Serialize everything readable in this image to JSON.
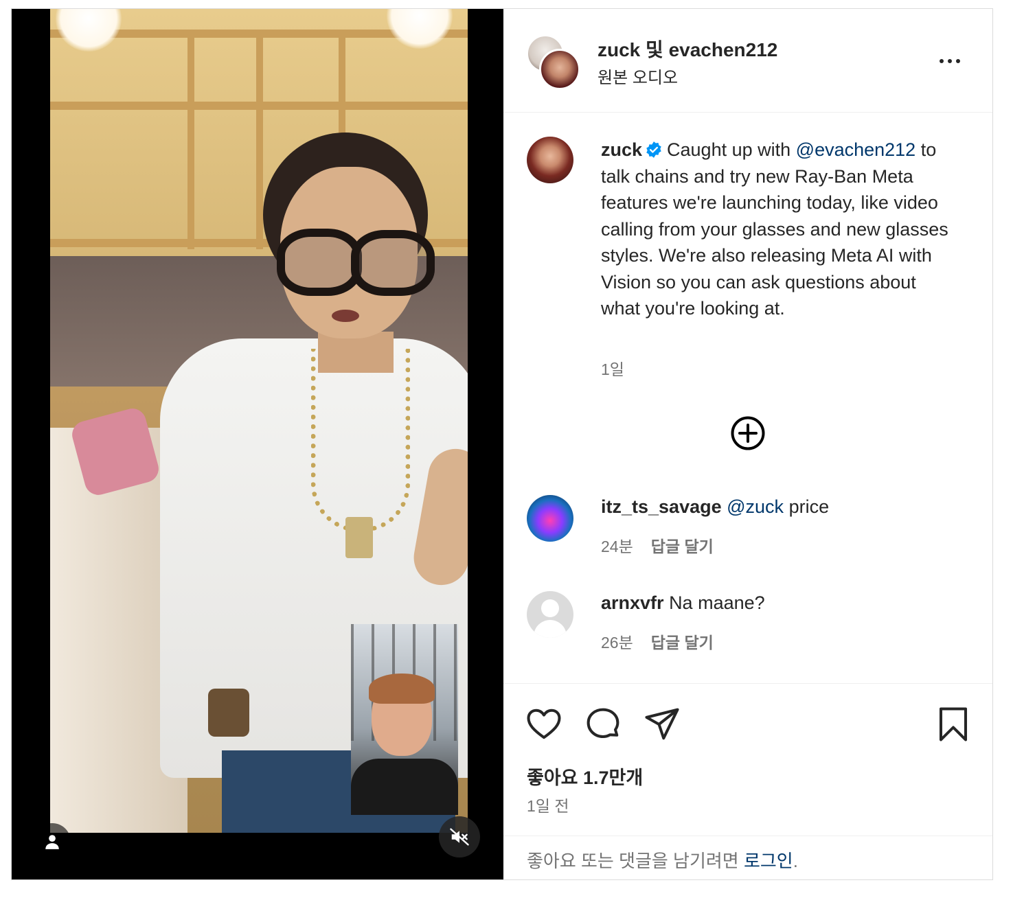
{
  "post": {
    "header": {
      "title": "zuck 및 evachen212",
      "subtitle": "원본 오디오"
    },
    "caption": {
      "username": "zuck",
      "text_before": "Caught up with ",
      "mention": "@evachen212",
      "text_after": " to talk chains and try new Ray-Ban Meta features we're launching today, like video calling from your glasses and new glasses styles. We're also releasing Meta AI with Vision so you can ask questions about what you're looking at.",
      "time": "1일"
    },
    "comments": [
      {
        "username": "itz_ts_savage",
        "mention": "@zuck",
        "text": "price",
        "time": "24분",
        "reply_label": "답글 달기"
      },
      {
        "username": "arnxvfr",
        "mention": "",
        "text": "Na maane?",
        "time": "26분",
        "reply_label": "답글 달기"
      }
    ],
    "likes_label": "좋아요 1.7만개",
    "date_label": "1일 전",
    "footer": {
      "text": "좋아요 또는 댓글을 남기려면 ",
      "login": "로그인",
      "suffix": "."
    }
  },
  "icons": {
    "more": "more-horizontal-icon",
    "verified": "verified-badge-icon",
    "load_more": "plus-circle-icon",
    "like": "heart-icon",
    "comment": "comment-bubble-icon",
    "share": "paper-plane-icon",
    "save": "bookmark-icon",
    "tagged": "user-icon",
    "mute": "muted-speaker-icon"
  },
  "colors": {
    "link": "#00376b",
    "verified": "#0095f6",
    "secondary_text": "#737373"
  }
}
